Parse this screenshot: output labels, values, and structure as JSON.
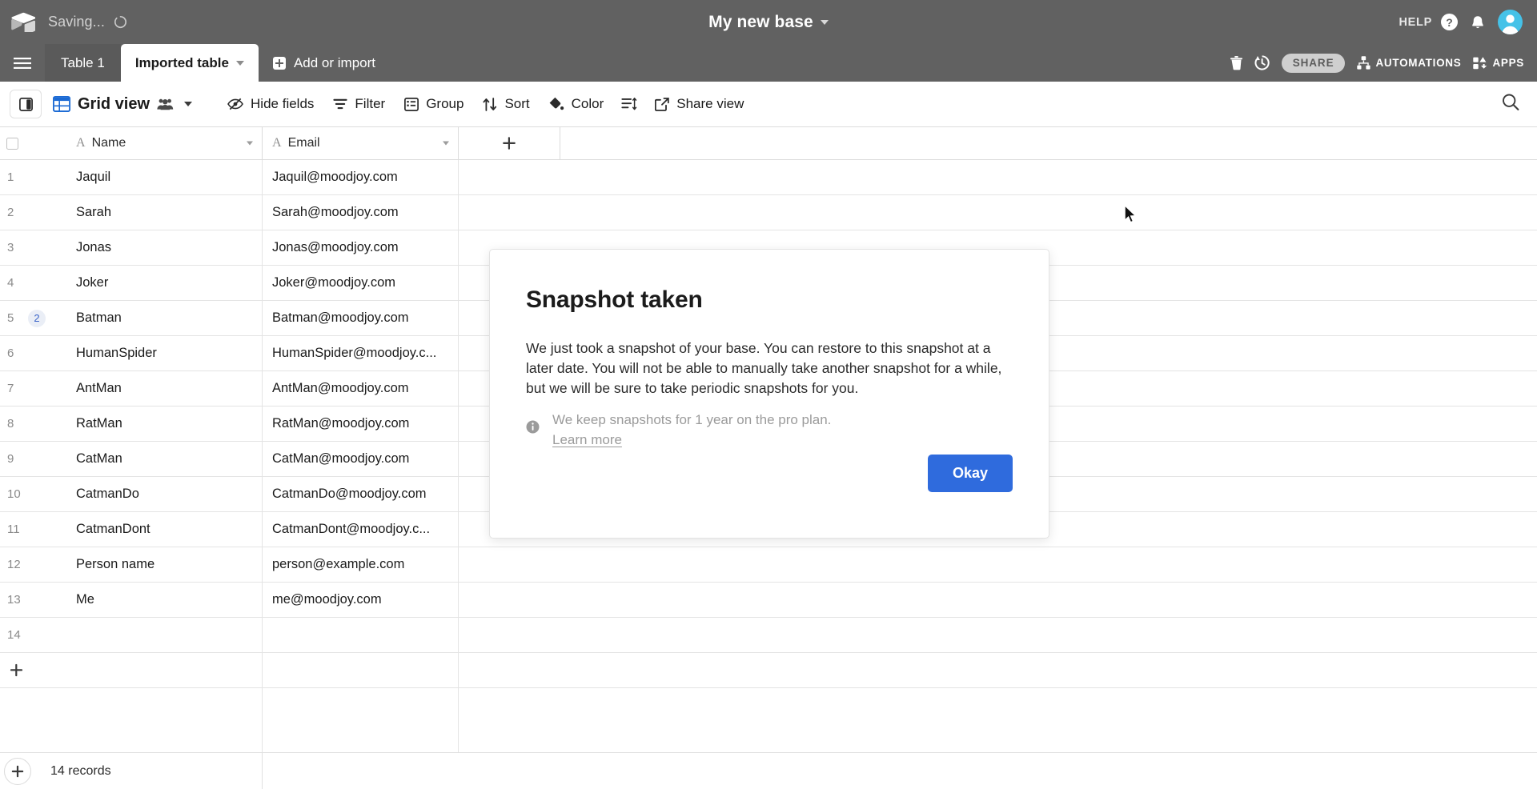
{
  "topbar": {
    "logo_icon": "airtable-logo-icon",
    "saving_text": "Saving...",
    "spinner_icon": "loading-spinner-icon",
    "base_title": "My new base",
    "base_caret_icon": "chevron-down-icon",
    "help_label": "HELP",
    "help_icon": "question-circle-icon",
    "notifications_icon": "bell-icon",
    "avatar_icon": "user-avatar",
    "avatar_color": "#45c2e8"
  },
  "tabbar": {
    "menu_icon": "hamburger-menu-icon",
    "tabs": [
      {
        "label": "Table 1",
        "active": false
      },
      {
        "label": "Imported table",
        "active": true
      }
    ],
    "tab_caret_icon": "chevron-down-icon",
    "add_label": "Add or import",
    "add_icon": "plus-square-icon",
    "trash_icon": "trash-icon",
    "history_icon": "history-clock-icon",
    "share_label": "SHARE",
    "automations_label": "AUTOMATIONS",
    "automations_icon": "automations-icon",
    "apps_label": "APPS",
    "apps_icon": "apps-icon"
  },
  "viewbar": {
    "sidebar_toggle_icon": "sidebar-toggle-icon",
    "grid_icon": "grid-view-icon",
    "view_name": "Grid view",
    "collaborators_icon": "collaborators-icon",
    "view_caret_icon": "chevron-down-icon",
    "buttons": [
      {
        "label": "Hide fields",
        "icon": "hide-fields-icon"
      },
      {
        "label": "Filter",
        "icon": "filter-icon"
      },
      {
        "label": "Group",
        "icon": "group-icon"
      },
      {
        "label": "Sort",
        "icon": "sort-icon"
      },
      {
        "label": "Color",
        "icon": "color-icon"
      }
    ],
    "row_height_icon": "row-height-icon",
    "share_view_label": "Share view",
    "share_view_icon": "share-view-icon",
    "search_icon": "search-icon"
  },
  "grid": {
    "select_all_icon": "checkbox-unchecked-icon",
    "columns": [
      {
        "name": "Name",
        "type_glyph": "A",
        "caret_icon": "chevron-down-icon"
      },
      {
        "name": "Email",
        "type_glyph": "A",
        "caret_icon": "chevron-down-icon"
      }
    ],
    "add_column_icon": "plus-icon",
    "rows": [
      {
        "num": "1",
        "name": "Jaquil",
        "email": "Jaquil@moodjoy.com",
        "comments": ""
      },
      {
        "num": "2",
        "name": "Sarah",
        "email": "Sarah@moodjoy.com",
        "comments": ""
      },
      {
        "num": "3",
        "name": "Jonas",
        "email": "Jonas@moodjoy.com",
        "comments": ""
      },
      {
        "num": "4",
        "name": "Joker",
        "email": "Joker@moodjoy.com",
        "comments": ""
      },
      {
        "num": "5",
        "name": "Batman",
        "email": "Batman@moodjoy.com",
        "comments": "2"
      },
      {
        "num": "6",
        "name": "HumanSpider",
        "email": "HumanSpider@moodjoy.c...",
        "comments": ""
      },
      {
        "num": "7",
        "name": "AntMan",
        "email": "AntMan@moodjoy.com",
        "comments": ""
      },
      {
        "num": "8",
        "name": "RatMan",
        "email": "RatMan@moodjoy.com",
        "comments": ""
      },
      {
        "num": "9",
        "name": "CatMan",
        "email": "CatMan@moodjoy.com",
        "comments": ""
      },
      {
        "num": "10",
        "name": "CatmanDo",
        "email": "CatmanDo@moodjoy.com",
        "comments": ""
      },
      {
        "num": "11",
        "name": "CatmanDont",
        "email": "CatmanDont@moodjoy.c...",
        "comments": ""
      },
      {
        "num": "12",
        "name": "Person name",
        "email": "person@example.com",
        "comments": ""
      },
      {
        "num": "13",
        "name": "Me",
        "email": "me@moodjoy.com",
        "comments": ""
      },
      {
        "num": "14",
        "name": "",
        "email": "",
        "comments": ""
      }
    ],
    "add_row_icon": "plus-icon"
  },
  "footer": {
    "add_record_icon": "plus-icon",
    "record_count": "14 records"
  },
  "modal": {
    "title": "Snapshot taken",
    "body": "We just took a snapshot of your base. You can restore to this snapshot at a later date. You will not be able to manually take another snapshot for a while, but we will be sure to take periodic snapshots for you.",
    "info_icon": "info-circle-icon",
    "note": "We keep snapshots for 1 year on the pro plan.",
    "learn_more": "Learn more",
    "okay_label": "Okay",
    "okay_color": "#2f6bdd"
  },
  "cursor": {
    "icon": "mouse-pointer-icon"
  }
}
